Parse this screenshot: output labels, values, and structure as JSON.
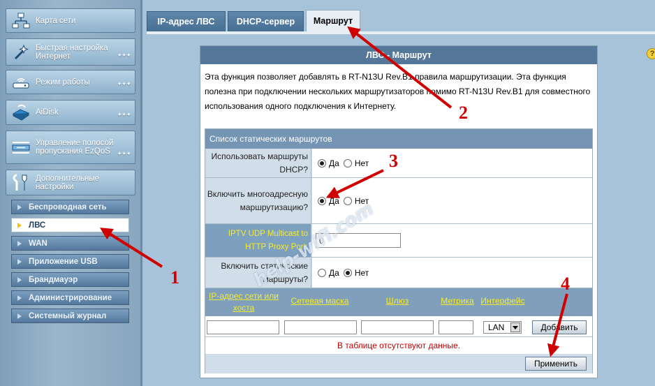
{
  "sidebar": {
    "items": [
      {
        "label": "Карта сети",
        "icon": "network-map-icon"
      },
      {
        "label": "Быстрая настройка Интернет",
        "icon": "magic-wand-icon"
      },
      {
        "label": "Режим работы",
        "icon": "router-icon"
      },
      {
        "label": "AiDisk",
        "icon": "disk-icon"
      },
      {
        "label": "Управление полосой пропускания EzQoS",
        "icon": "qos-icon"
      },
      {
        "label": "Дополнительные настройки",
        "icon": "tools-icon"
      }
    ],
    "submenu": [
      {
        "label": "Беспроводная сеть",
        "active": false
      },
      {
        "label": "ЛВС",
        "active": true
      },
      {
        "label": "WAN",
        "active": false
      },
      {
        "label": "Приложение USB",
        "active": false
      },
      {
        "label": "Брандмауэр",
        "active": false
      },
      {
        "label": "Администрирование",
        "active": false
      },
      {
        "label": "Системный журнал",
        "active": false
      }
    ]
  },
  "tabs": [
    {
      "label": "IP-адрес ЛВС",
      "active": false
    },
    {
      "label": "DHCP-сервер",
      "active": false
    },
    {
      "label": "Маршрут",
      "active": true
    }
  ],
  "help_icon": "?",
  "panel": {
    "title": "ЛВС - Маршрут",
    "description": "Эта функция позволяет добавлять в RT-N13U Rev.B1 правила маршрутизации. Эта функция полезна при подключении нескольких маршрутизаторов помимо RT-N13U Rev.B1 для совместного использования одного подключения к Интернету."
  },
  "routes": {
    "title": "Список статических маршрутов",
    "use_dhcp_routes": {
      "label": "Использовать маршруты DHCP?",
      "yes": "Да",
      "no": "Нет",
      "value": "Да"
    },
    "multicast_routing": {
      "label": "Включить многоадресную маршрутизацию?",
      "yes": "Да",
      "no": "Нет",
      "value": "Да"
    },
    "iptv_proxy_port": {
      "label": "IPTV UDP Multicast to HTTP Proxy Port:",
      "value": "0"
    },
    "static_routes": {
      "label": "Включить статические маршруты?",
      "yes": "Да",
      "no": "Нет",
      "value": "Нет"
    },
    "columns": [
      "IP-адрес сети или хоста",
      "Сетевая маска",
      "Шлюз",
      "Метрика",
      "Интерфейс"
    ],
    "interface_value": "LAN",
    "add_button": "Добавить",
    "empty_message": "В таблице отсутствуют данные.",
    "apply_button": "Применить"
  },
  "annotations": {
    "n1": "1",
    "n2": "2",
    "n3": "3",
    "n4": "4",
    "color": "#d10000"
  },
  "watermark": "help-wifi.com"
}
